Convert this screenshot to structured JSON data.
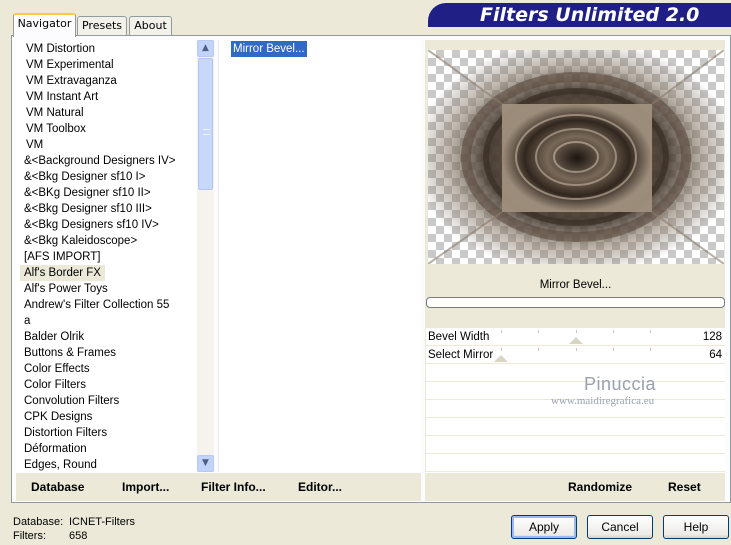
{
  "window": {
    "title_banner": "Filters Unlimited 2.0"
  },
  "tabs": [
    {
      "label": "Navigator",
      "active": true
    },
    {
      "label": "Presets",
      "active": false
    },
    {
      "label": "About",
      "active": false
    }
  ],
  "categories": [
    {
      "label": "VM Distortion",
      "indent": true,
      "selected": false
    },
    {
      "label": "VM Experimental",
      "indent": true,
      "selected": false
    },
    {
      "label": "VM Extravaganza",
      "indent": true,
      "selected": false
    },
    {
      "label": "VM Instant Art",
      "indent": true,
      "selected": false
    },
    {
      "label": "VM Natural",
      "indent": true,
      "selected": false
    },
    {
      "label": "VM Toolbox",
      "indent": true,
      "selected": false
    },
    {
      "label": "VM",
      "indent": true,
      "selected": false
    },
    {
      "label": "&<Background Designers IV>",
      "indent": false,
      "selected": false
    },
    {
      "label": "&<Bkg Designer sf10 I>",
      "indent": false,
      "selected": false
    },
    {
      "label": "&<BKg Designer sf10 II>",
      "indent": false,
      "selected": false
    },
    {
      "label": "&<Bkg Designer sf10 III>",
      "indent": false,
      "selected": false
    },
    {
      "label": "&<Bkg Designers sf10 IV>",
      "indent": false,
      "selected": false
    },
    {
      "label": "&<Bkg Kaleidoscope>",
      "indent": false,
      "selected": false
    },
    {
      "label": "[AFS IMPORT]",
      "indent": false,
      "selected": false
    },
    {
      "label": "Alf's Border FX",
      "indent": false,
      "selected": true
    },
    {
      "label": "Alf's Power Toys",
      "indent": false,
      "selected": false
    },
    {
      "label": "Andrew's Filter Collection 55",
      "indent": false,
      "selected": false
    },
    {
      "label": "a",
      "indent": false,
      "selected": false
    },
    {
      "label": "Balder Olrik",
      "indent": false,
      "selected": false
    },
    {
      "label": "Buttons & Frames",
      "indent": false,
      "selected": false
    },
    {
      "label": "Color Effects",
      "indent": false,
      "selected": false
    },
    {
      "label": "Color Filters",
      "indent": false,
      "selected": false
    },
    {
      "label": "Convolution Filters",
      "indent": false,
      "selected": false
    },
    {
      "label": "CPK Designs",
      "indent": false,
      "selected": false
    },
    {
      "label": "Distortion Filters",
      "indent": false,
      "selected": false
    },
    {
      "label": "Déformation",
      "indent": false,
      "selected": false
    },
    {
      "label": "Edges, Round",
      "indent": false,
      "selected": false
    }
  ],
  "filters": [
    {
      "label": "Mirror Bevel...",
      "selected": true
    }
  ],
  "preview": {
    "filter_name": "Mirror Bevel..."
  },
  "parameters": [
    {
      "label": "Bevel Width",
      "value": "128",
      "slider_fraction": 0.502
    },
    {
      "label": "Select Mirror",
      "value": "64",
      "slider_fraction": 0.251
    }
  ],
  "watermark": {
    "line1": "Pinuccia",
    "line2": "www.maidiregrafica.eu"
  },
  "toolbar": {
    "database": "Database",
    "import": "Import...",
    "filter_info": "Filter Info...",
    "editor": "Editor...",
    "randomize": "Randomize",
    "reset": "Reset"
  },
  "status": {
    "database_label": "Database:",
    "database_value": "ICNET-Filters",
    "filters_label": "Filters:",
    "filters_value": "658"
  },
  "dialog": {
    "apply": "Apply",
    "cancel": "Cancel",
    "help": "Help"
  },
  "icons": {
    "scroll_up": "▲",
    "scroll_down": "▼"
  },
  "colors": {
    "banner": "#1f1f85",
    "selection": "#316ac5",
    "tab_highlight": "#ffc73c"
  }
}
